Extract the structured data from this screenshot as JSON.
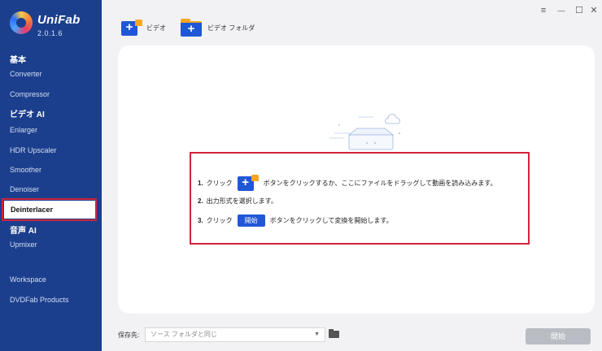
{
  "app": {
    "name": "UniFab",
    "version": "2.0.1.6"
  },
  "sidebar": {
    "sections": {
      "basic": "基本",
      "video_ai": "ビデオ AI",
      "audio_ai": "音声 AI"
    },
    "items": {
      "converter": "Converter",
      "compressor": "Compressor",
      "enlarger": "Enlarger",
      "hdr_upscaler": "HDR Upscaler",
      "smoother": "Smoother",
      "denoiser": "Denoiser",
      "deinterlacer": "Deinterlacer",
      "upmixer": "Upmixer",
      "workspace": "Workspace",
      "dvdfab_products": "DVDFab Products"
    },
    "active_item": "Deinterlacer"
  },
  "toolbar": {
    "video_label": "ビデオ",
    "video_folder_label": "ビデオ フォルダ"
  },
  "window_controls": {
    "menu": "≡",
    "minimize": "—",
    "maximize": "☐",
    "close": "✕"
  },
  "guide": {
    "step1_num": "1.",
    "step1_prefix": "クリック",
    "step1_suffix": "ボタンをクリックするか、ここにファイルをドラッグして動画を読み込みます。",
    "step2_num": "2.",
    "step2_text": "出力形式を選択します。",
    "step3_num": "3.",
    "step3_prefix": "クリック",
    "step3_chip": "開始",
    "step3_suffix": "ボタンをクリックして変換を開始します。"
  },
  "bottom": {
    "save_label": "保存先:",
    "save_value": "ソース フォルダと同じ",
    "start_button": "開始"
  },
  "colors": {
    "sidebar_bg": "#1c3f8d",
    "accent": "#2057d6",
    "highlight_border": "#d0243a",
    "start_disabled": "#b9bcc2"
  }
}
